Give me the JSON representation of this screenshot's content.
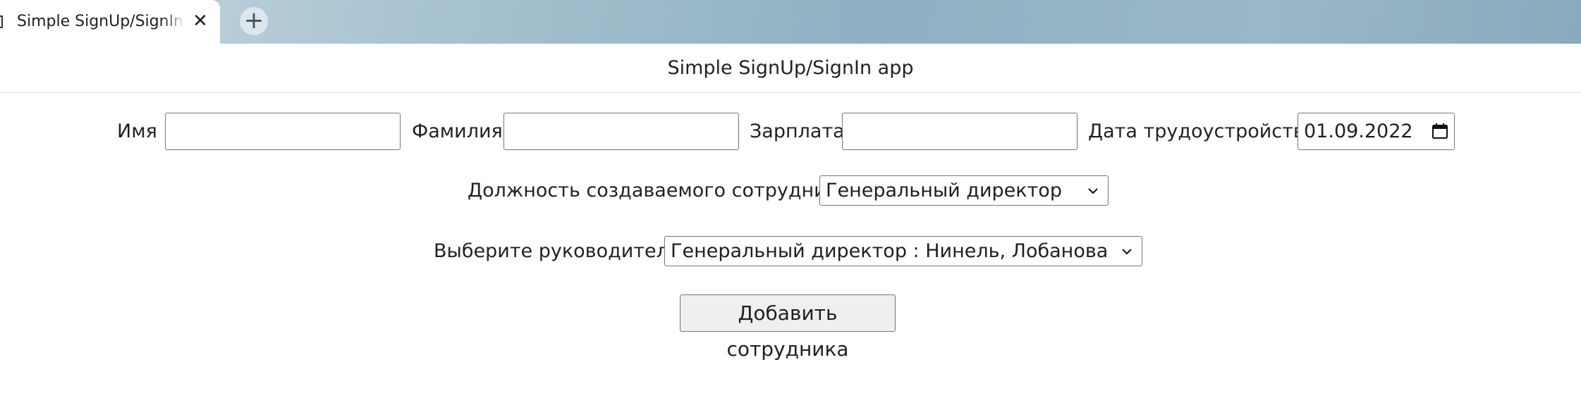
{
  "browser": {
    "tab_title": "Simple SignUp/SignIn app",
    "close_glyph": "✕",
    "new_tab_glyph": "+"
  },
  "header": {
    "title": "Simple SignUp/SignIn app"
  },
  "form": {
    "first_name": {
      "label": "Имя",
      "value": ""
    },
    "last_name": {
      "label": "Фамилия",
      "value": ""
    },
    "salary": {
      "label": "Зарплата",
      "value": ""
    },
    "hire_date": {
      "label": "Дата трудоустройства",
      "value": "01.09.2022"
    },
    "position": {
      "label": "Должность создаваемого сотрудника",
      "selected": "Генеральный директор"
    },
    "manager": {
      "label": "Выберите руководителя",
      "selected": "Генеральный директор : Нинель, Лобанова"
    },
    "submit_label": "Добавить сотрудника"
  },
  "icons": [
    "close-icon",
    "plus-icon",
    "calendar-icon",
    "chevron-down-icon"
  ]
}
